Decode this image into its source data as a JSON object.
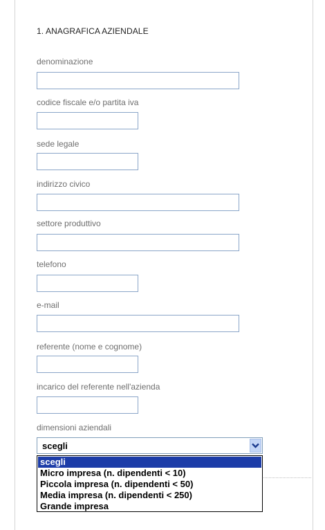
{
  "form": {
    "section_title": "1. ANAGRAFICA AZIENDALE",
    "fields": {
      "denominazione": {
        "label": "denominazione",
        "value": ""
      },
      "codice_fiscale": {
        "label": "codice fiscale e/o partita iva",
        "value": ""
      },
      "sede_legale": {
        "label": "sede legale",
        "value": ""
      },
      "indirizzo": {
        "label": "indirizzo civico",
        "value": ""
      },
      "settore": {
        "label": "settore produttivo",
        "value": ""
      },
      "telefono": {
        "label": "telefono",
        "value": ""
      },
      "email": {
        "label": "e-mail",
        "value": ""
      },
      "referente": {
        "label": "referente (nome e cognome)",
        "value": ""
      },
      "incarico": {
        "label": "incarico del referente nell'azienda",
        "value": ""
      }
    },
    "dimensioni": {
      "label": "dimensioni aziendali",
      "selected": "scegli",
      "options": [
        "scegli",
        "Micro impresa (n. dipendenti < 10)",
        "Piccola impresa (n. dipendenti < 50)",
        "Media impresa (n. dipendenti < 250)",
        "Grande impresa"
      ]
    }
  },
  "colors": {
    "input_border": "#8aa5c8",
    "selected_option_bg": "#1c3ca8",
    "dropdown_button": "#c4d6f6"
  }
}
